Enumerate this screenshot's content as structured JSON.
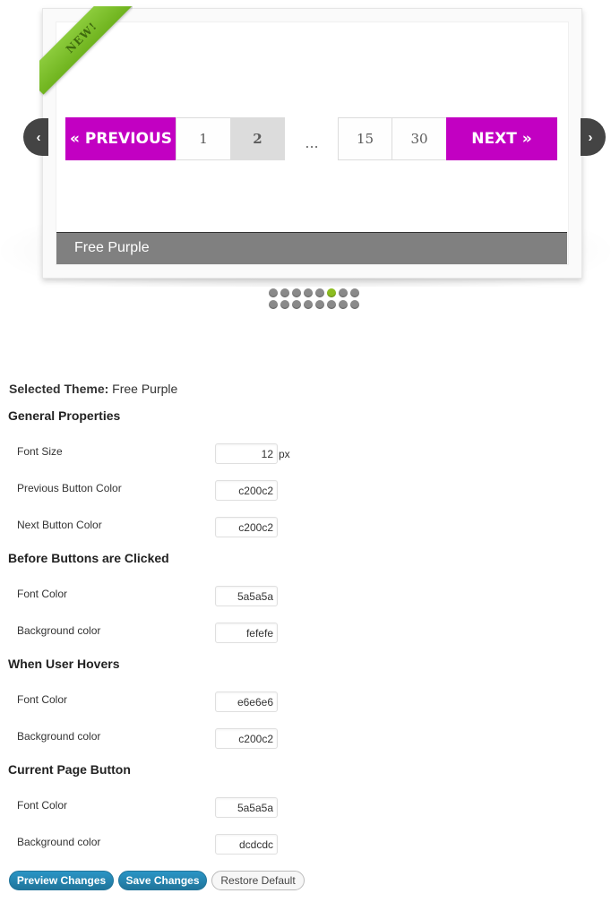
{
  "slider": {
    "ribbon_label": "NEW!",
    "prev_arrow_icon": "chevron-left-icon",
    "next_arrow_icon": "chevron-right-icon",
    "prev_arrow_glyph": "‹",
    "next_arrow_glyph": "›",
    "pager": {
      "previous_label": "« PREVIOUS",
      "next_label": "NEXT »",
      "pages": [
        "1",
        "2",
        "...",
        "15",
        "30"
      ],
      "current_page": "2"
    },
    "caption": "Free Purple",
    "dot_count": 16,
    "active_dot_index": 5
  },
  "form": {
    "selected_theme_label": "Selected Theme:",
    "selected_theme_value": "Free Purple",
    "sections": {
      "general": {
        "title": "General Properties",
        "font_size_label": "Font Size",
        "font_size_value": "12",
        "font_size_unit": "px",
        "prev_color_label": "Previous Button Color",
        "prev_color_value": "c200c2",
        "next_color_label": "Next Button Color",
        "next_color_value": "c200c2"
      },
      "before_click": {
        "title": "Before Buttons are Clicked",
        "font_color_label": "Font Color",
        "font_color_value": "5a5a5a",
        "bg_color_label": "Background color",
        "bg_color_value": "fefefe"
      },
      "hover": {
        "title": "When User Hovers",
        "font_color_label": "Font Color",
        "font_color_value": "e6e6e6",
        "bg_color_label": "Background color",
        "bg_color_value": "c200c2"
      },
      "current": {
        "title": "Current Page Button",
        "font_color_label": "Font Color",
        "font_color_value": "5a5a5a",
        "bg_color_label": "Background color",
        "bg_color_value": "dcdcdc"
      }
    },
    "buttons": {
      "preview": "Preview Changes",
      "save": "Save Changes",
      "restore": "Restore Default"
    }
  },
  "colors": {
    "theme_purple": "#c200c2",
    "pager_font": "#5a5a5a",
    "pager_bg": "#fefefe",
    "current_bg": "#dcdcdc",
    "ribbon_green": "#7dbf2e",
    "wp_blue": "#21759b"
  }
}
